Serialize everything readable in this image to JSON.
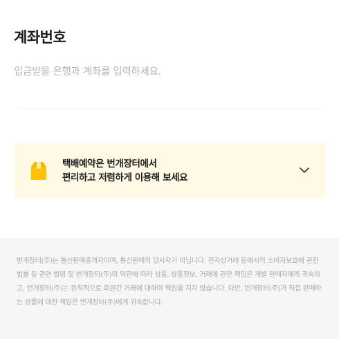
{
  "header": {
    "title": "계좌번호"
  },
  "account": {
    "placeholder": "입금받을 은행과 계좌를 입력하세요.",
    "value": ""
  },
  "promo": {
    "line1": "택배예약은 번개장터에서",
    "line2": "편리하고 저렴하게 이용해 보세요",
    "icon": "box-icon",
    "expand_icon": "chevron-down-icon"
  },
  "notice": {
    "text": "번개장터(주)는 통신판매중개자이며, 통신판매의 당사자가 아닙니다. 전자상거래 등에서의 소비자보호에 관한 법률 등 관련 법령 및 번개장터(주)의 약관에 따라 상품, 상품정보, 거래에 관한 책임은 개별 판매자에게 귀속하고, 번개장터(주)는 원칙적으로 회원간 거래에 대하여 책임을 지지 않습니다. 다만, 번개장터(주)가 직접 판매하는 상품에 대한 책임은 번개장터(주)에게 귀속합니다."
  },
  "colors": {
    "accent": "#ffc107",
    "banner_bg": "#fff9e6",
    "notice_bg": "#f6f6f6"
  }
}
